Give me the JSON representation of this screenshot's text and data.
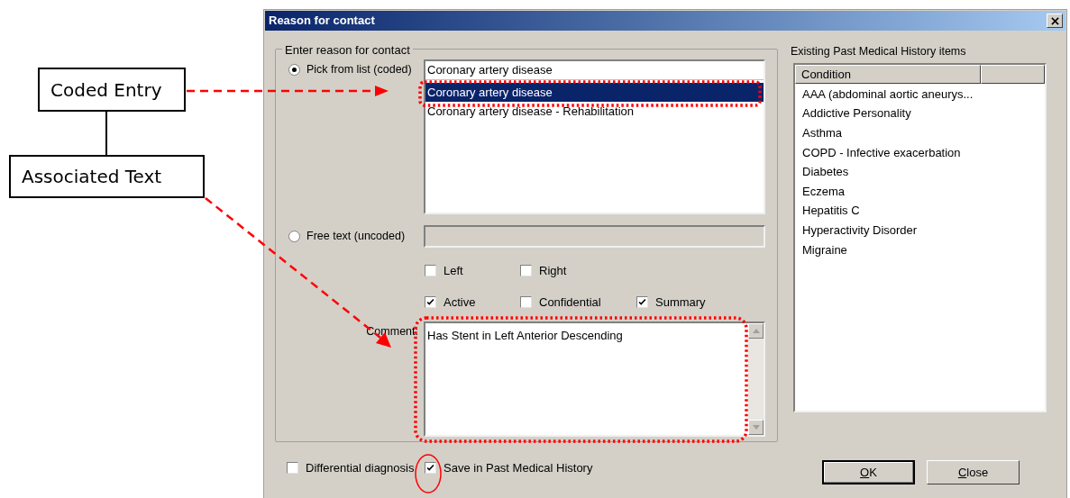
{
  "window": {
    "title": "Reason for contact"
  },
  "callouts": [
    {
      "text": "Coded Entry"
    },
    {
      "text": "Associated Text"
    }
  ],
  "reason_group": {
    "legend": "Enter reason for contact",
    "options": [
      {
        "kind": "coded",
        "label": "Pick from list (coded)",
        "selected": true
      },
      {
        "kind": "free",
        "label": "Free text (uncoded)",
        "selected": false
      }
    ],
    "coded_entry": {
      "value": "Coronary artery disease",
      "items": [
        {
          "label": "Coronary artery disease",
          "selected": true
        },
        {
          "label": "Coronary artery disease - Rehabilitation",
          "selected": false
        }
      ]
    },
    "free_text": {
      "disabled": true
    },
    "checkbox_rows": [
      [
        {
          "label": "Left",
          "checked": false
        },
        {
          "label": "Right",
          "checked": false
        }
      ],
      [
        {
          "label": "Active",
          "checked": true
        },
        {
          "label": "Confidential",
          "checked": false
        },
        {
          "label": "Summary",
          "checked": true
        }
      ]
    ],
    "comment": {
      "label": "Comment:",
      "value": "Has Stent in Left Anterior Descending"
    }
  },
  "bottom_options": [
    {
      "label": "Differential diagnosis",
      "checked": false
    },
    {
      "label": "Save in Past Medical History",
      "checked": true
    }
  ],
  "history": {
    "title": "Existing Past Medical History items",
    "columns": [
      "Condition"
    ],
    "items": [
      "AAA (abdominal aortic aneurys...",
      "Addictive Personality",
      "Asthma",
      "COPD - Infective exacerbation",
      "Diabetes",
      "Eczema",
      "Hepatitis C",
      "Hyperactivity Disorder",
      "Migraine"
    ]
  },
  "buttons": [
    {
      "label": "OK",
      "default": true
    },
    {
      "label": "Close",
      "default": false
    }
  ]
}
